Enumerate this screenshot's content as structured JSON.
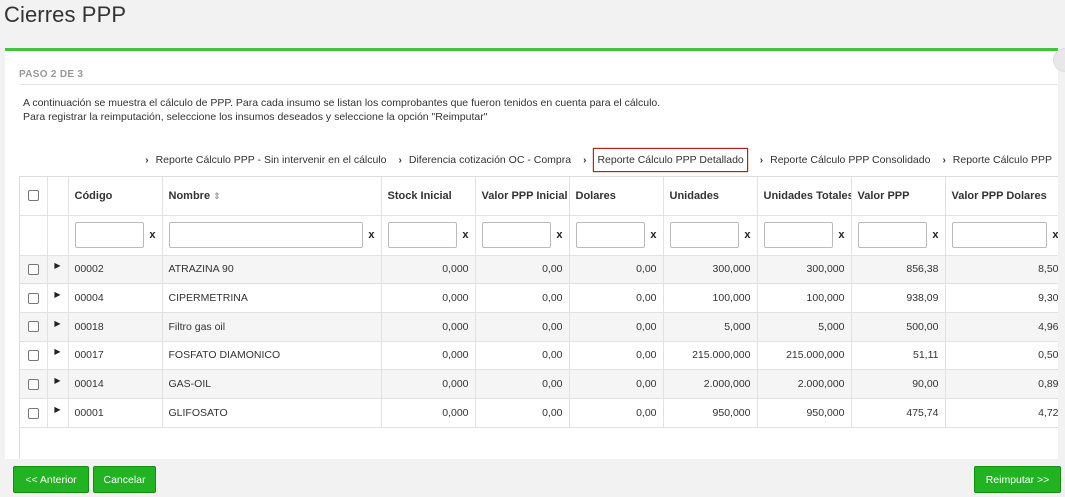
{
  "page": {
    "title": "Cierres PPP"
  },
  "step": {
    "label": "PASO 2 DE 3"
  },
  "intro": {
    "line1": "A continuación se muestra el cálculo de PPP. Para cada insumo se listan los comprobantes que fueron tenidos en cuenta para el cálculo.",
    "line2": "Para registrar la reimputación, seleccione los insumos deseados y seleccione la opción \"Reimputar\""
  },
  "crumbs": [
    {
      "label": "Reporte Cálculo PPP - Sin intervenir en el cálculo",
      "active": false
    },
    {
      "label": "Diferencia cotización OC - Compra",
      "active": false
    },
    {
      "label": "Reporte Cálculo PPP Detallado",
      "active": true
    },
    {
      "label": "Reporte Cálculo PPP Consolidado",
      "active": false
    },
    {
      "label": "Reporte Cálculo PPP",
      "active": false
    }
  ],
  "table": {
    "columns": [
      "Código",
      "Nombre",
      "Stock Inicial",
      "Valor PPP Inicial",
      "Dolares",
      "Unidades",
      "Unidades Totales",
      "Valor PPP",
      "Valor PPP Dolares"
    ],
    "filter_clear": "x",
    "rows": [
      {
        "codigo": "00002",
        "nombre": "ATRAZINA 90",
        "stock_inicial": "0,000",
        "valor_ppp_inicial": "0,00",
        "dolares": "0,00",
        "unidades": "300,000",
        "unidades_totales": "300,000",
        "valor_ppp": "856,38",
        "valor_ppp_dolares": "8,50"
      },
      {
        "codigo": "00004",
        "nombre": "CIPERMETRINA",
        "stock_inicial": "0,000",
        "valor_ppp_inicial": "0,00",
        "dolares": "0,00",
        "unidades": "100,000",
        "unidades_totales": "100,000",
        "valor_ppp": "938,09",
        "valor_ppp_dolares": "9,30"
      },
      {
        "codigo": "00018",
        "nombre": "Filtro gas oil",
        "stock_inicial": "0,000",
        "valor_ppp_inicial": "0,00",
        "dolares": "0,00",
        "unidades": "5,000",
        "unidades_totales": "5,000",
        "valor_ppp": "500,00",
        "valor_ppp_dolares": "4,96"
      },
      {
        "codigo": "00017",
        "nombre": "FOSFATO DIAMONICO",
        "stock_inicial": "0,000",
        "valor_ppp_inicial": "0,00",
        "dolares": "0,00",
        "unidades": "215.000,000",
        "unidades_totales": "215.000,000",
        "valor_ppp": "51,11",
        "valor_ppp_dolares": "0,50"
      },
      {
        "codigo": "00014",
        "nombre": "GAS-OIL",
        "stock_inicial": "0,000",
        "valor_ppp_inicial": "0,00",
        "dolares": "0,00",
        "unidades": "2.000,000",
        "unidades_totales": "2.000,000",
        "valor_ppp": "90,00",
        "valor_ppp_dolares": "0,89"
      },
      {
        "codigo": "00001",
        "nombre": "GLIFOSATO",
        "stock_inicial": "0,000",
        "valor_ppp_inicial": "0,00",
        "dolares": "0,00",
        "unidades": "950,000",
        "unidades_totales": "950,000",
        "valor_ppp": "475,74",
        "valor_ppp_dolares": "4,72"
      }
    ]
  },
  "buttons": {
    "previous": "<< Anterior",
    "cancel": "Cancelar",
    "reimpute": "Reimputar >>"
  },
  "colors": {
    "accent": "#3fc53a",
    "button": "#21b321",
    "active_crumb_border": "#bb2222"
  }
}
